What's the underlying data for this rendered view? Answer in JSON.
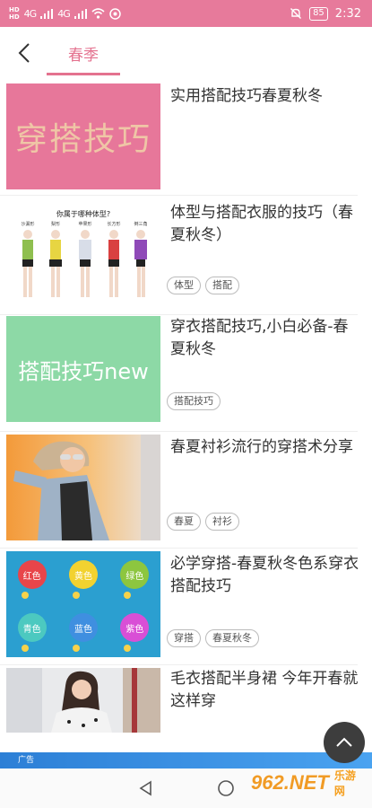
{
  "status_bar": {
    "hd_1": "HD",
    "hd_2": "HD",
    "sig_1": "4G",
    "sig_2": "4G",
    "battery": "85",
    "time": "2:32"
  },
  "header": {
    "tab_label": "春季"
  },
  "items": [
    {
      "title": "实用搭配技巧春夏秋冬",
      "thumb_text": "穿搭技巧",
      "thumb_bg": "#e7779a",
      "thumb_fg": "#f0c8a8",
      "tags": []
    },
    {
      "title": "体型与搭配衣服的技巧（春夏秋冬）",
      "thumb_caption": "你属于哪种体型?",
      "thumb_labels": [
        "沙漏形",
        "梨形",
        "苹果形",
        "长方形",
        "倒三角"
      ],
      "tags": [
        "体型",
        "搭配"
      ]
    },
    {
      "title": "穿衣搭配技巧,小白必备-春夏秋冬",
      "thumb_text": "搭配技巧new",
      "thumb_bg": "#8dd9a6",
      "thumb_fg": "#ffffff",
      "tags": [
        "搭配技巧"
      ]
    },
    {
      "title": "春夏衬衫流行的穿搭术分享",
      "tags": [
        "春夏",
        "衬衫"
      ]
    },
    {
      "title": "必学穿搭-春夏秋冬色系穿衣搭配技巧",
      "color_circles": [
        {
          "label": "红色",
          "color": "#e8454a"
        },
        {
          "label": "黄色",
          "color": "#f2d230"
        },
        {
          "label": "绿色",
          "color": "#8dc63f"
        },
        {
          "label": "青色",
          "color": "#4cc9c0"
        },
        {
          "label": "蓝色",
          "color": "#3f8fe0"
        },
        {
          "label": "紫色",
          "color": "#d94fd6"
        }
      ],
      "thumb_bg": "#2b9fd0",
      "tags": [
        "穿搭",
        "春夏秋冬"
      ]
    },
    {
      "title": "毛衣搭配半身裙 今年开春就这样穿",
      "tags": []
    }
  ],
  "ad": {
    "label": "广告",
    "logo": "962.NET",
    "logo_sub": "乐游网"
  },
  "colors": {
    "accent": "#e4728f",
    "status_bar": "#e77a9b"
  }
}
